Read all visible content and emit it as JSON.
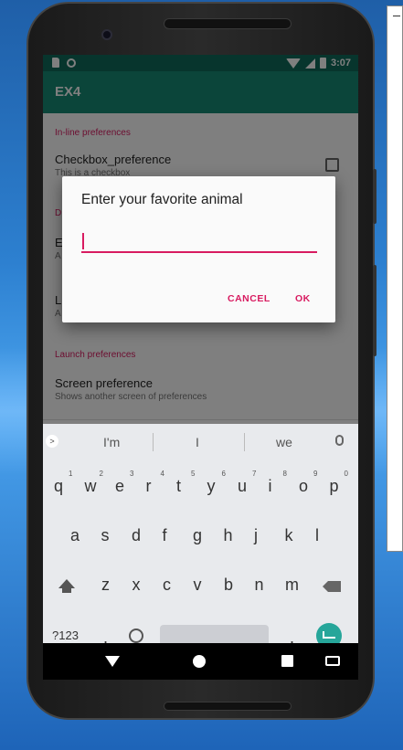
{
  "status_bar": {
    "time": "3:07"
  },
  "app": {
    "title": "EX4"
  },
  "preferences": {
    "inline_category": "In-line preferences",
    "checkbox_title": "Checkbox_preference",
    "checkbox_summary": "This is a checkbox",
    "dialog_category": "D",
    "edittext_title": "E",
    "edittext_summary": "A",
    "list_title": "L",
    "list_summary": "A",
    "launch_category": "Launch preferences",
    "screen_title": "Screen preference",
    "screen_summary": "Shows another screen of preferences"
  },
  "dialog": {
    "title": "Enter your favorite animal",
    "input_value": "",
    "cancel_label": "CANCEL",
    "ok_label": "OK"
  },
  "keyboard": {
    "suggestions": [
      "I'm",
      "I",
      "we"
    ],
    "row1": [
      "q",
      "w",
      "e",
      "r",
      "t",
      "y",
      "u",
      "i",
      "o",
      "p"
    ],
    "row1_hints": [
      "1",
      "2",
      "3",
      "4",
      "5",
      "6",
      "7",
      "8",
      "9",
      "0"
    ],
    "row2": [
      "a",
      "s",
      "d",
      "f",
      "g",
      "h",
      "j",
      "k",
      "l"
    ],
    "row3": [
      "z",
      "x",
      "c",
      "v",
      "b",
      "n",
      "m"
    ],
    "symbols_key": "?123",
    "comma_key": ",",
    "period_key": "."
  },
  "colors": {
    "accent": "#d81b60",
    "app_bar": "#178b74",
    "status_bar": "#0f6a5a",
    "enter_key": "#26a69a"
  }
}
